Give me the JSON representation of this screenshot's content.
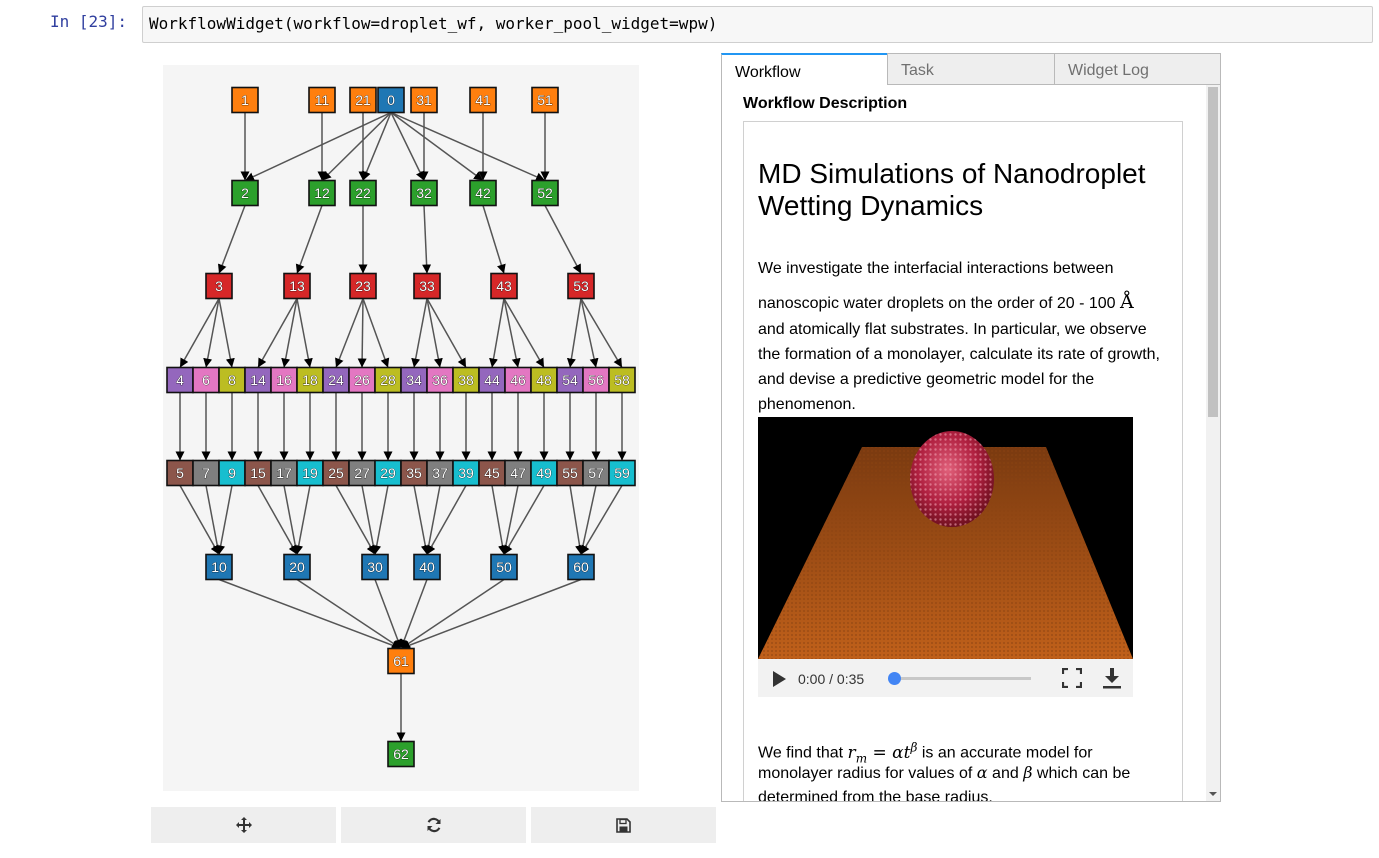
{
  "cell": {
    "prompt": "In [23]:",
    "code": "WorkflowWidget(workflow=droplet_wf, worker_pool_widget=wpw)"
  },
  "toolbar": {
    "move_icon": "move-arrows-icon",
    "refresh_icon": "refresh-icon",
    "save_icon": "floppy-disk-icon"
  },
  "tabs": [
    {
      "label": "Workflow",
      "active": true
    },
    {
      "label": "Task",
      "active": false
    },
    {
      "label": "Widget Log",
      "active": false
    }
  ],
  "workflow_tab": {
    "section_label": "Workflow Description",
    "title": "MD Simulations of Nanodroplet Wetting Dynamics",
    "para1_lines": [
      "We investigate the interfacial interactions between",
      "nanoscopic water droplets on the order of 20 - 100",
      "and atomically flat substrates. In particular, we observe",
      "the formation of a monolayer, calculate its rate of growth,",
      "and devise a predictive geometric model for the",
      "phenomenon."
    ],
    "angstrom": "Å",
    "video": {
      "time": "0:00 / 0:35",
      "progress": 0.0
    },
    "para2": {
      "line1_pre": "We find that",
      "formula": "r_m = αt^β",
      "line1_post": "is an accurate model for",
      "line2_pre": "monolayer radius for values of",
      "alpha": "α",
      "and": "and",
      "beta": "β",
      "line2_post": "which can be",
      "line3": "determined from the base radius."
    }
  },
  "colors": {
    "orange": "#ff7f0e",
    "green": "#2ca02c",
    "red": "#d62728",
    "blue": "#1f77b4",
    "purple": "#9467bd",
    "pink": "#e377c2",
    "olive": "#bcbd22",
    "brown": "#8c564b",
    "gray": "#7f7f7f",
    "cyan": "#17becf"
  },
  "graph": {
    "rows": [
      [
        "1",
        "11",
        "21",
        "0",
        "31",
        "41",
        "51"
      ],
      [
        "2",
        "12",
        "22",
        "32",
        "42",
        "52"
      ],
      [
        "3",
        "13",
        "23",
        "33",
        "43",
        "53"
      ],
      [
        "4",
        "6",
        "8",
        "14",
        "16",
        "18",
        "24",
        "26",
        "28",
        "34",
        "36",
        "38",
        "44",
        "46",
        "48",
        "54",
        "56",
        "58"
      ],
      [
        "5",
        "7",
        "9",
        "15",
        "17",
        "19",
        "25",
        "27",
        "29",
        "35",
        "37",
        "39",
        "45",
        "47",
        "49",
        "55",
        "57",
        "59"
      ],
      [
        "10",
        "20",
        "30",
        "40",
        "50",
        "60"
      ],
      [
        "61"
      ],
      [
        "62"
      ]
    ],
    "node_colors": {
      "0": "blue",
      "1": "orange",
      "11": "orange",
      "21": "orange",
      "31": "orange",
      "41": "orange",
      "51": "orange",
      "2": "green",
      "12": "green",
      "22": "green",
      "32": "green",
      "42": "green",
      "52": "green",
      "3": "red",
      "13": "red",
      "23": "red",
      "33": "red",
      "43": "red",
      "53": "red",
      "4": "purple",
      "14": "purple",
      "24": "purple",
      "34": "purple",
      "44": "purple",
      "54": "purple",
      "6": "pink",
      "16": "pink",
      "26": "pink",
      "36": "pink",
      "46": "pink",
      "56": "pink",
      "8": "olive",
      "18": "olive",
      "28": "olive",
      "38": "olive",
      "48": "olive",
      "58": "olive",
      "5": "brown",
      "15": "brown",
      "25": "brown",
      "35": "brown",
      "45": "brown",
      "55": "brown",
      "7": "gray",
      "17": "gray",
      "27": "gray",
      "37": "gray",
      "47": "gray",
      "57": "gray",
      "9": "cyan",
      "19": "cyan",
      "29": "cyan",
      "39": "cyan",
      "49": "cyan",
      "59": "cyan",
      "10": "blue",
      "20": "blue",
      "30": "blue",
      "40": "blue",
      "50": "blue",
      "60": "blue",
      "61": "orange",
      "62": "green"
    },
    "edges": [
      [
        "1",
        "2"
      ],
      [
        "11",
        "12"
      ],
      [
        "21",
        "22"
      ],
      [
        "31",
        "32"
      ],
      [
        "41",
        "42"
      ],
      [
        "51",
        "52"
      ],
      [
        "0",
        "2"
      ],
      [
        "0",
        "12"
      ],
      [
        "0",
        "22"
      ],
      [
        "0",
        "32"
      ],
      [
        "0",
        "42"
      ],
      [
        "0",
        "52"
      ],
      [
        "2",
        "3"
      ],
      [
        "12",
        "13"
      ],
      [
        "22",
        "23"
      ],
      [
        "32",
        "33"
      ],
      [
        "42",
        "43"
      ],
      [
        "52",
        "53"
      ],
      [
        "3",
        "4"
      ],
      [
        "3",
        "6"
      ],
      [
        "3",
        "8"
      ],
      [
        "13",
        "14"
      ],
      [
        "13",
        "16"
      ],
      [
        "13",
        "18"
      ],
      [
        "23",
        "24"
      ],
      [
        "23",
        "26"
      ],
      [
        "23",
        "28"
      ],
      [
        "33",
        "34"
      ],
      [
        "33",
        "36"
      ],
      [
        "33",
        "38"
      ],
      [
        "43",
        "44"
      ],
      [
        "43",
        "46"
      ],
      [
        "43",
        "48"
      ],
      [
        "53",
        "54"
      ],
      [
        "53",
        "56"
      ],
      [
        "53",
        "58"
      ],
      [
        "4",
        "5"
      ],
      [
        "6",
        "7"
      ],
      [
        "8",
        "9"
      ],
      [
        "14",
        "15"
      ],
      [
        "16",
        "17"
      ],
      [
        "18",
        "19"
      ],
      [
        "24",
        "25"
      ],
      [
        "26",
        "27"
      ],
      [
        "28",
        "29"
      ],
      [
        "34",
        "35"
      ],
      [
        "36",
        "37"
      ],
      [
        "38",
        "39"
      ],
      [
        "44",
        "45"
      ],
      [
        "46",
        "47"
      ],
      [
        "48",
        "49"
      ],
      [
        "54",
        "55"
      ],
      [
        "56",
        "57"
      ],
      [
        "58",
        "59"
      ],
      [
        "5",
        "10"
      ],
      [
        "7",
        "10"
      ],
      [
        "9",
        "10"
      ],
      [
        "15",
        "20"
      ],
      [
        "17",
        "20"
      ],
      [
        "19",
        "20"
      ],
      [
        "25",
        "30"
      ],
      [
        "27",
        "30"
      ],
      [
        "29",
        "30"
      ],
      [
        "35",
        "40"
      ],
      [
        "37",
        "40"
      ],
      [
        "39",
        "40"
      ],
      [
        "45",
        "50"
      ],
      [
        "47",
        "50"
      ],
      [
        "49",
        "50"
      ],
      [
        "55",
        "60"
      ],
      [
        "57",
        "60"
      ],
      [
        "59",
        "60"
      ],
      [
        "10",
        "61"
      ],
      [
        "20",
        "61"
      ],
      [
        "30",
        "61"
      ],
      [
        "40",
        "61"
      ],
      [
        "50",
        "61"
      ],
      [
        "60",
        "61"
      ],
      [
        "61",
        "62"
      ]
    ]
  }
}
